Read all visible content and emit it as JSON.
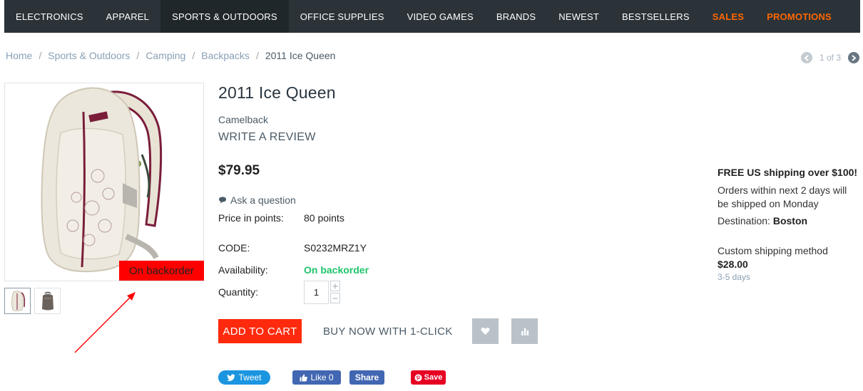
{
  "nav": {
    "items": [
      {
        "label": "ELECTRONICS"
      },
      {
        "label": "APPAREL"
      },
      {
        "label": "SPORTS & OUTDOORS"
      },
      {
        "label": "OFFICE SUPPLIES"
      },
      {
        "label": "VIDEO GAMES"
      },
      {
        "label": "BRANDS"
      },
      {
        "label": "NEWEST"
      },
      {
        "label": "BESTSELLERS"
      },
      {
        "label": "SALES"
      },
      {
        "label": "PROMOTIONS"
      }
    ],
    "accent_color": "#ff6600"
  },
  "breadcrumb": {
    "items": [
      "Home",
      "Sports & Outdoors",
      "Camping",
      "Backpacks",
      "2011 Ice Queen"
    ],
    "separator": "/"
  },
  "pager": {
    "text": "1 of 3"
  },
  "product": {
    "title": "2011 Ice Queen",
    "brand": "Camelback",
    "review_link": "WRITE A REVIEW",
    "price": "$79.95",
    "ask_question": "Ask a question",
    "badge": "On backorder",
    "badge_color": "#ff0000",
    "details": {
      "points_label": "Price in points:",
      "points_value": "80 points",
      "code_label": "CODE:",
      "code_value": "S0232MRZ1Y",
      "availability_label": "Availability:",
      "availability_value": "On backorder",
      "quantity_label": "Quantity:",
      "quantity_value": "1"
    },
    "add_to_cart": "ADD TO CART",
    "buy_now": "BUY NOW WITH 1-CLICK",
    "cart_button_color": "#ff2a0d"
  },
  "social": {
    "tweet": "Tweet",
    "like": "Like 0",
    "share": "Share",
    "save": "Save"
  },
  "shipping": {
    "free_shipping": "FREE US shipping over $100!",
    "orders_text": "Orders within next 2 days will be shipped on Monday",
    "destination_label": "Destination:",
    "destination_value": "Boston",
    "method_label": "Custom shipping method",
    "method_price": "$28.00",
    "method_days": "3-5 days"
  }
}
